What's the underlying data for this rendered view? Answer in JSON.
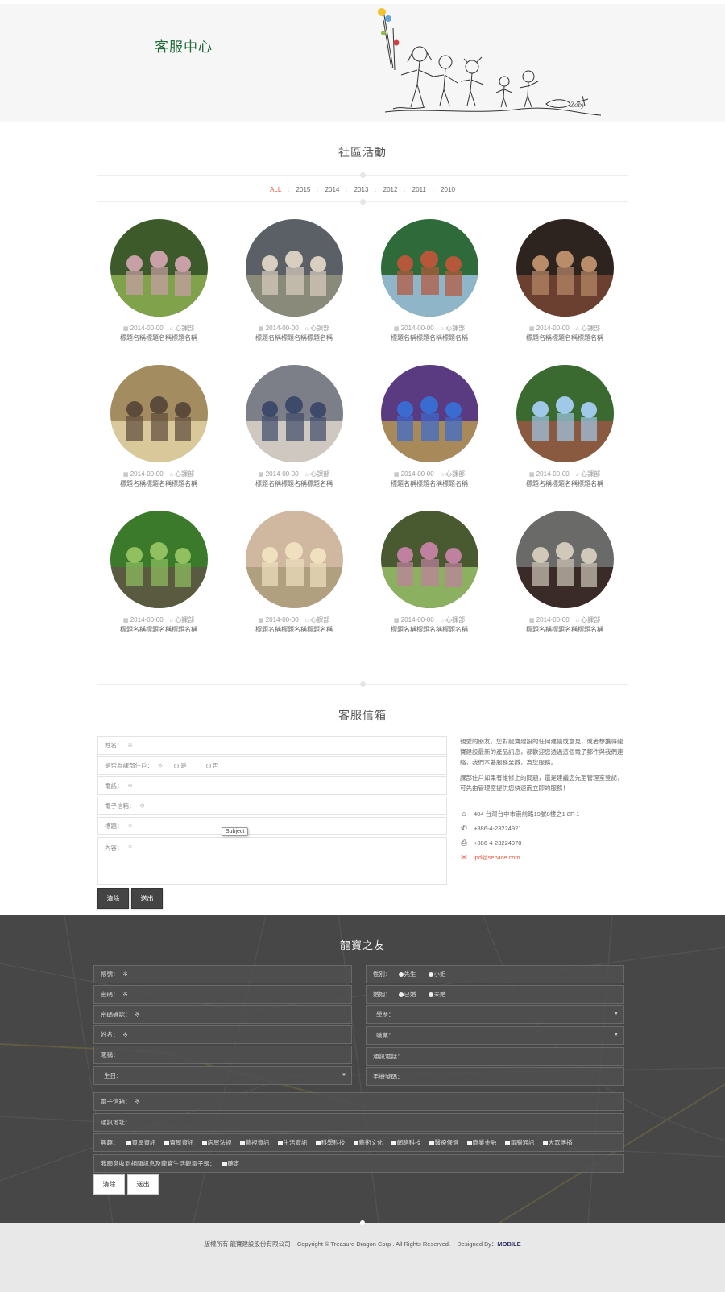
{
  "header": {
    "title": "客服中心"
  },
  "activities": {
    "title": "社區活動",
    "filters": [
      "ALL",
      "2015",
      "2014",
      "2013",
      "2012",
      "2011",
      "2010"
    ],
    "cards": [
      {
        "date": "2014-00-00",
        "category": "心課部",
        "title": "標題名稱標題名稱標題名稱"
      },
      {
        "date": "2014-00-00",
        "category": "心課部",
        "title": "標題名稱標題名稱標題名稱"
      },
      {
        "date": "2014-00-00",
        "category": "心課部",
        "title": "標題名稱標題名稱標題名稱"
      },
      {
        "date": "2014-00-00",
        "category": "心課部",
        "title": "標題名稱標題名稱標題名稱"
      },
      {
        "date": "2014-00-00",
        "category": "心課部",
        "title": "標題名稱標題名稱標題名稱"
      },
      {
        "date": "2014-00-00",
        "category": "心課部",
        "title": "標題名稱標題名稱標題名稱"
      },
      {
        "date": "2014-00-00",
        "category": "心課部",
        "title": "標題名稱標題名稱標題名稱"
      },
      {
        "date": "2014-00-00",
        "category": "心課部",
        "title": "標題名稱標題名稱標題名稱"
      },
      {
        "date": "2014-00-00",
        "category": "心課部",
        "title": "標題名稱標題名稱標題名稱"
      },
      {
        "date": "2014-00-00",
        "category": "心課部",
        "title": "標題名稱標題名稱標題名稱"
      },
      {
        "date": "2014-00-00",
        "category": "心課部",
        "title": "標題名稱標題名稱標題名稱"
      },
      {
        "date": "2014-00-00",
        "category": "心課部",
        "title": "標題名稱標題名稱標題名稱"
      }
    ]
  },
  "service": {
    "title": "客服信箱",
    "fields": {
      "name": "姓名：",
      "resident": "是否為課部住戶：",
      "resident_yes": "是",
      "resident_no": "否",
      "phone": "電話：",
      "email": "電子信箱：",
      "subject": "標題：",
      "content": "內容："
    },
    "required_mark": "※",
    "tooltip": "Subject",
    "clear_label": "清除",
    "submit_label": "送出",
    "intro1": "親愛的朋友，您對龍寶建設的任何建議或意見，或者想獲得龍寶建設最新的產品訊息，都歡迎您透過這個電子郵件與我們連絡，我們本著服務至誠，為您服務。",
    "intro2": "課部住戶如果有維修上的問題，還是建議您先至管理室登記，可先由管理室提供您快速而立即的服務！",
    "address": "404 台灣台中市崇前路19號8樓之1 8F-1",
    "tel": "+886-4-23224921",
    "fax": "+886-4-23224978",
    "mail": "lpd@service.com"
  },
  "friends": {
    "title": "龍寶之友",
    "account": "帳號：",
    "password": "密碼：",
    "password_confirm": "密碼確認：",
    "name": "姓名：",
    "nickname": "暱稱：",
    "birthday": "生日：",
    "gender": "性別：",
    "gender_m": "先生",
    "gender_f": "小姐",
    "marriage": "婚姻：",
    "married": "已婚",
    "single": "未婚",
    "education": "學歷：",
    "job": "職業：",
    "contact_phone": "通訊電話：",
    "mobile": "手機號碼：",
    "email": "電子信箱：",
    "address": "通訊地址：",
    "interest": "興趣：",
    "interests": [
      "買屋資訊",
      "賣屋資訊",
      "房屋法規",
      "藝視資訊",
      "生活資訊",
      "科學科技",
      "藝術文化",
      "網路科技",
      "醫療保健",
      "商業金融",
      "電腦通訊",
      "大眾傳播"
    ],
    "newsletter": "我願意收到相關訊息及龍寶生活觀電子報：",
    "newsletter_opt": "確定",
    "required_mark": "※",
    "clear_label": "清除",
    "submit_label": "送出"
  },
  "footer": {
    "rights": "版權所有 龍寶建設股份有限公司",
    "copyright": "Copyright © Treasure Dragon Corp . All Rights Reserved.",
    "designed": "Designed By：",
    "designer": "MOBILE"
  },
  "colors": {
    "accent": "#e5553c",
    "title_green": "#1f6b3a",
    "dark_bg": "#474747",
    "footer_bg": "#e8e8e8"
  }
}
